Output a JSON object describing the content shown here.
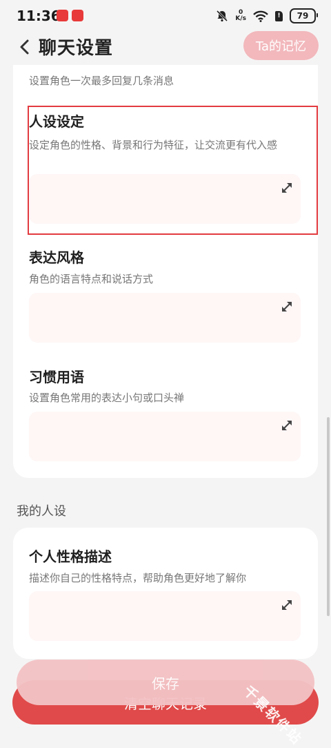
{
  "status_bar": {
    "time": "11:36",
    "net_speed_value": "0",
    "net_speed_unit": "K/s",
    "battery": "79",
    "icons": [
      "app-badge-icon",
      "mute-bell-icon",
      "wifi-icon",
      "sim-icon",
      "battery-icon"
    ]
  },
  "header": {
    "title": "聊天设置",
    "memory_button": "Ta的记忆"
  },
  "settings": {
    "max_reply_desc": "设置角色一次最多回复几条消息",
    "persona": {
      "title": "人设设定",
      "desc": "设定角色的性格、背景和行为特征，让交流更有代入感",
      "value": ""
    },
    "style": {
      "title": "表达风格",
      "desc": "角色的语言特点和说话方式",
      "value": ""
    },
    "phrases": {
      "title": "习惯用语",
      "desc": "设置角色常用的表达小句或口头禅",
      "value": ""
    }
  },
  "my_persona": {
    "group_label": "我的人设",
    "personality": {
      "title": "个人性格描述",
      "desc": "描述你自己的性格特点，帮助角色更好地了解你",
      "value": ""
    }
  },
  "footer": {
    "save_button": "保存",
    "clear_button": "清空聊天记录"
  },
  "watermark": "千景软件站",
  "colors": {
    "accent_pink": "#f2b8bc",
    "danger_red": "#e04a4a",
    "highlight_border": "#e23a3f",
    "textbox_bg": "#fff6f6"
  }
}
